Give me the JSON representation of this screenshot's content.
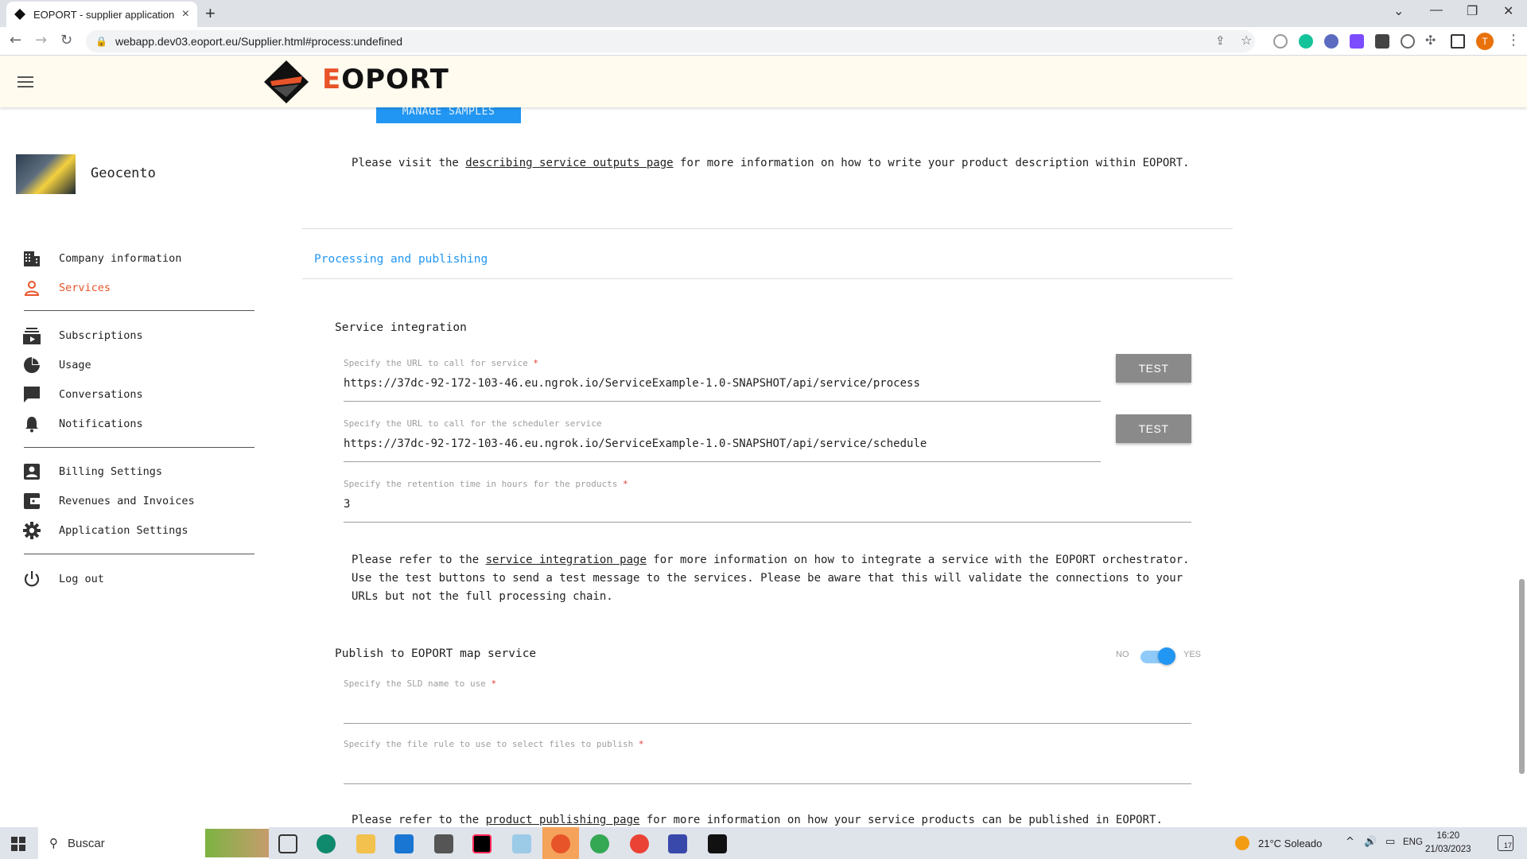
{
  "browser": {
    "tab_title": "EOPORT - supplier application",
    "tab_close": "×",
    "new_tab": "+",
    "url": "webapp.dev03.eoport.eu/Supplier.html#process:undefined",
    "avatar_letter": "T"
  },
  "header": {
    "logo_text_e": "E",
    "logo_text_rest": "OPORT"
  },
  "content": {
    "manage_samples_label": "MANAGE SAMPLES",
    "outputs_para_prefix": "Please visit the ",
    "outputs_para_link": "describing service outputs page",
    "outputs_para_suffix": " for more information on how to write your product description within EOPORT.",
    "section_title": "Processing and publishing",
    "service_integration_title": "Service integration",
    "url_label": "Specify the URL to call for service",
    "url_value": "https://37dc-92-172-103-46.eu.ngrok.io/ServiceExample-1.0-SNAPSHOT/api/service/process",
    "scheduler_label": "Specify the URL to call for the scheduler service",
    "scheduler_value": "https://37dc-92-172-103-46.eu.ngrok.io/ServiceExample-1.0-SNAPSHOT/api/service/schedule",
    "retention_label": "Specify the retention time in hours for the products",
    "retention_value": "3",
    "required_mark": "*",
    "test_label": "TEST",
    "integration_para_prefix": "Please refer to the ",
    "integration_para_link": "service integration page",
    "integration_para_suffix": " for more information on how to integrate a service with the EOPORT orchestrator.",
    "integration_para_line2": "Use the test buttons to send a test message to the services. Please be aware that this will validate the connections to your",
    "integration_para_line3": "URLs but not the full processing chain.",
    "publish_title": "Publish to EOPORT map service",
    "toggle_no": "NO",
    "toggle_yes": "YES",
    "sld_label": "Specify the SLD name to use",
    "file_rule_label": "Specify the file rule to use to select files to publish",
    "publishing_para_prefix": "Please refer to the ",
    "publishing_para_link": "product publishing page",
    "publishing_para_suffix": " for more information on how your service products can be published in EOPORT."
  },
  "company": {
    "name": "Geocento"
  },
  "sidebar": {
    "items": [
      {
        "label": "Company information"
      },
      {
        "label": "Services"
      },
      {
        "label": "Subscriptions"
      },
      {
        "label": "Usage"
      },
      {
        "label": "Conversations"
      },
      {
        "label": "Notifications"
      },
      {
        "label": "Billing Settings"
      },
      {
        "label": "Revenues and Invoices"
      },
      {
        "label": "Application Settings"
      },
      {
        "label": "Log out"
      }
    ]
  },
  "taskbar": {
    "search_placeholder": "Buscar",
    "weather": "21°C  Soleado",
    "language": "ENG",
    "time": "16:20",
    "date": "21/03/2023",
    "notification_count": "17"
  },
  "colors": {
    "accent": "#2196f3",
    "brand": "#e8542a",
    "header_bg": "#fffbef"
  }
}
